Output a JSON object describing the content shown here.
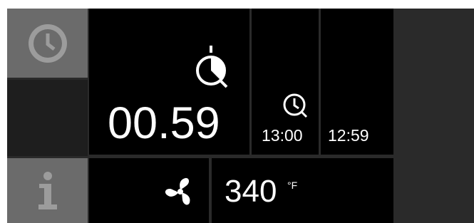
{
  "timer": {
    "value": "00.59"
  },
  "start": {
    "time": "13:00"
  },
  "end": {
    "time": "12:59"
  },
  "oven": {
    "temperature": "340",
    "unit": "°F"
  },
  "sidebar": {
    "clock_icon": "clock-icon",
    "info_icon": "info-icon"
  },
  "icons": {
    "timer": "stopwatch-icon",
    "start_clock": "clock-icon",
    "fan": "fan-icon"
  },
  "colors": {
    "background": "#000000",
    "frame": "#2a2a2a",
    "side_button": "#6b6b6b",
    "icon_gray": "#9c9c9c",
    "text": "#ffffff"
  }
}
